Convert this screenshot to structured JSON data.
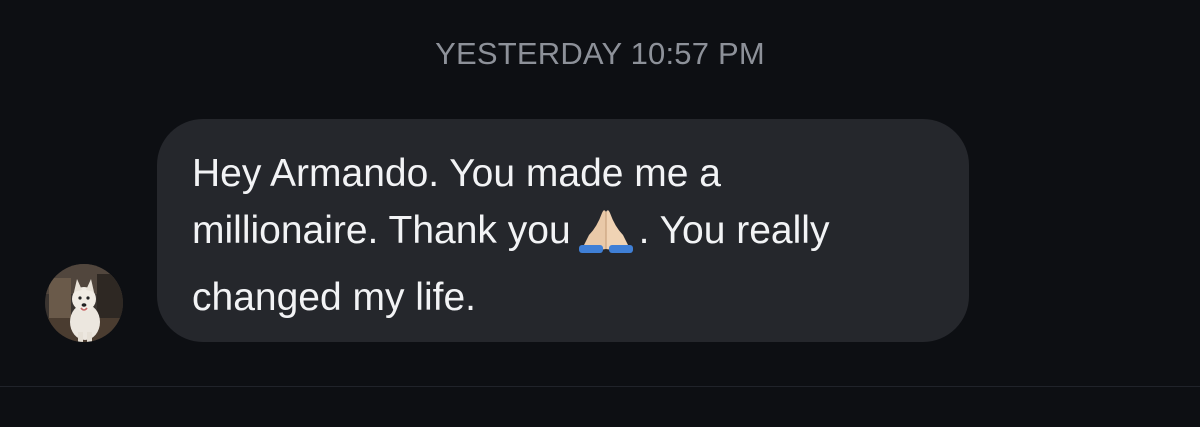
{
  "conversation": {
    "timestamp": "YESTERDAY 10:57 PM"
  },
  "message": {
    "line1": "Hey Armando. You made me a",
    "line2_before_emoji": "millionaire. Thank you",
    "emoji": "folded-hands-emoji",
    "line2_after_emoji": ". You really",
    "line3": "changed my life."
  },
  "sender": {
    "avatar_icon": "dog-avatar"
  },
  "colors": {
    "background": "#0d0f13",
    "bubble": "#25272c",
    "text": "#f2f3f5",
    "timestamp": "#8d9199"
  }
}
